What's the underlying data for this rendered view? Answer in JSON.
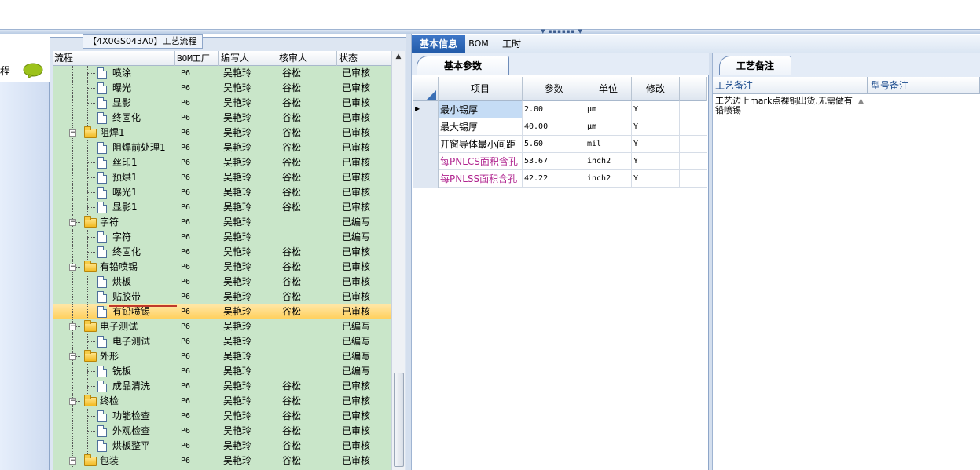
{
  "left_strip": {
    "label": "程"
  },
  "process": {
    "group_title": "【4X0GS043A0】工艺流程",
    "columns": [
      "流程",
      "BOM工厂",
      "编写人",
      "核审人",
      "状态"
    ],
    "rows": [
      {
        "level": 2,
        "type": "doc",
        "name": "喷涂",
        "factory": "P6",
        "author": "吴艳玲",
        "reviewer": "谷松",
        "status": "已审核"
      },
      {
        "level": 2,
        "type": "doc",
        "name": "曝光",
        "factory": "P6",
        "author": "吴艳玲",
        "reviewer": "谷松",
        "status": "已审核"
      },
      {
        "level": 2,
        "type": "doc",
        "name": "显影",
        "factory": "P6",
        "author": "吴艳玲",
        "reviewer": "谷松",
        "status": "已审核"
      },
      {
        "level": 2,
        "type": "doc",
        "name": "终固化",
        "factory": "P6",
        "author": "吴艳玲",
        "reviewer": "谷松",
        "status": "已审核"
      },
      {
        "level": 1,
        "type": "folder",
        "name": "阻焊1",
        "factory": "P6",
        "author": "吴艳玲",
        "reviewer": "谷松",
        "status": "已审核"
      },
      {
        "level": 2,
        "type": "doc",
        "name": "阻焊前处理1",
        "factory": "P6",
        "author": "吴艳玲",
        "reviewer": "谷松",
        "status": "已审核"
      },
      {
        "level": 2,
        "type": "doc",
        "name": "丝印1",
        "factory": "P6",
        "author": "吴艳玲",
        "reviewer": "谷松",
        "status": "已审核"
      },
      {
        "level": 2,
        "type": "doc",
        "name": "预烘1",
        "factory": "P6",
        "author": "吴艳玲",
        "reviewer": "谷松",
        "status": "已审核"
      },
      {
        "level": 2,
        "type": "doc",
        "name": "曝光1",
        "factory": "P6",
        "author": "吴艳玲",
        "reviewer": "谷松",
        "status": "已审核"
      },
      {
        "level": 2,
        "type": "doc",
        "name": "显影1",
        "factory": "P6",
        "author": "吴艳玲",
        "reviewer": "谷松",
        "status": "已审核"
      },
      {
        "level": 1,
        "type": "folder",
        "name": "字符",
        "factory": "P6",
        "author": "吴艳玲",
        "reviewer": "",
        "status": "已编写"
      },
      {
        "level": 2,
        "type": "doc",
        "name": "字符",
        "factory": "P6",
        "author": "吴艳玲",
        "reviewer": "",
        "status": "已编写"
      },
      {
        "level": 2,
        "type": "doc",
        "name": "终固化",
        "factory": "P6",
        "author": "吴艳玲",
        "reviewer": "谷松",
        "status": "已审核"
      },
      {
        "level": 1,
        "type": "folder",
        "name": "有铅喷锡",
        "factory": "P6",
        "author": "吴艳玲",
        "reviewer": "谷松",
        "status": "已审核"
      },
      {
        "level": 2,
        "type": "doc",
        "name": "烘板",
        "factory": "P6",
        "author": "吴艳玲",
        "reviewer": "谷松",
        "status": "已审核"
      },
      {
        "level": 2,
        "type": "doc",
        "name": "贴胶带",
        "factory": "P6",
        "author": "吴艳玲",
        "reviewer": "谷松",
        "status": "已审核"
      },
      {
        "level": 2,
        "type": "doc",
        "name": "有铅喷锡",
        "factory": "P6",
        "author": "吴艳玲",
        "reviewer": "谷松",
        "status": "已审核",
        "selected": true
      },
      {
        "level": 1,
        "type": "folder",
        "name": "电子测试",
        "factory": "P6",
        "author": "吴艳玲",
        "reviewer": "",
        "status": "已编写"
      },
      {
        "level": 2,
        "type": "doc",
        "name": "电子测试",
        "factory": "P6",
        "author": "吴艳玲",
        "reviewer": "",
        "status": "已编写"
      },
      {
        "level": 1,
        "type": "folder",
        "name": "外形",
        "factory": "P6",
        "author": "吴艳玲",
        "reviewer": "",
        "status": "已编写"
      },
      {
        "level": 2,
        "type": "doc",
        "name": "铣板",
        "factory": "P6",
        "author": "吴艳玲",
        "reviewer": "",
        "status": "已编写"
      },
      {
        "level": 2,
        "type": "doc",
        "name": "成品清洗",
        "factory": "P6",
        "author": "吴艳玲",
        "reviewer": "谷松",
        "status": "已审核"
      },
      {
        "level": 1,
        "type": "folder",
        "name": "终检",
        "factory": "P6",
        "author": "吴艳玲",
        "reviewer": "谷松",
        "status": "已审核"
      },
      {
        "level": 2,
        "type": "doc",
        "name": "功能检查",
        "factory": "P6",
        "author": "吴艳玲",
        "reviewer": "谷松",
        "status": "已审核"
      },
      {
        "level": 2,
        "type": "doc",
        "name": "外观检查",
        "factory": "P6",
        "author": "吴艳玲",
        "reviewer": "谷松",
        "status": "已审核"
      },
      {
        "level": 2,
        "type": "doc",
        "name": "烘板整平",
        "factory": "P6",
        "author": "吴艳玲",
        "reviewer": "谷松",
        "status": "已审核"
      },
      {
        "level": 1,
        "type": "folder",
        "name": "包装",
        "factory": "P6",
        "author": "吴艳玲",
        "reviewer": "谷松",
        "status": "已审核"
      }
    ]
  },
  "tabs": {
    "basic_info": "基本信息",
    "bom": "BOM",
    "work_hours": "工时"
  },
  "params": {
    "panel_title": "基本参数",
    "columns": [
      "项目",
      "参数",
      "单位",
      "修改"
    ],
    "rows": [
      {
        "item": "最小锡厚",
        "value": "2.00",
        "unit": "μm",
        "modify": "Y",
        "highlight": false,
        "current": true
      },
      {
        "item": "最大锡厚",
        "value": "40.00",
        "unit": "μm",
        "modify": "Y",
        "highlight": false
      },
      {
        "item": "开窗导体最小间距",
        "value": "5.60",
        "unit": "mil",
        "modify": "Y",
        "highlight": false
      },
      {
        "item": "每PNLCS面积含孔",
        "value": "53.67",
        "unit": "inch2",
        "modify": "Y",
        "highlight": true
      },
      {
        "item": "每PNLSS面积含孔",
        "value": "42.22",
        "unit": "inch2",
        "modify": "Y",
        "highlight": true
      }
    ]
  },
  "notes": {
    "panel_title": "工艺备注",
    "process_note_header": "工艺备注",
    "model_note_header": "型号备注",
    "process_note_text": "工艺边上mark点裸铜出货,无需做有铅喷锡"
  },
  "colors": {
    "tree_bg": "#c9e6c9",
    "selected_row": "#ffcf5a",
    "active_tab": "#215aa8",
    "highlight_text": "#b0248f"
  }
}
